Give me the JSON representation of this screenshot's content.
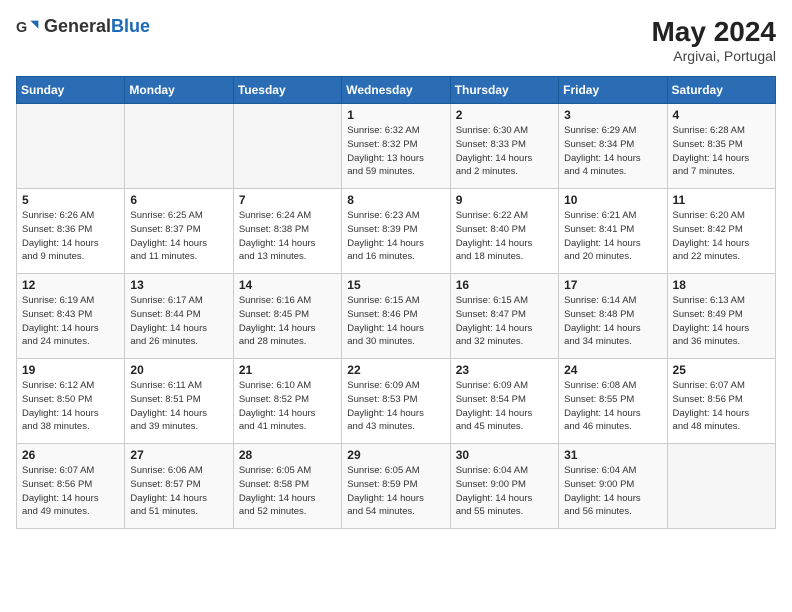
{
  "header": {
    "logo_general": "General",
    "logo_blue": "Blue",
    "month_year": "May 2024",
    "location": "Argivai, Portugal"
  },
  "days_of_week": [
    "Sunday",
    "Monday",
    "Tuesday",
    "Wednesday",
    "Thursday",
    "Friday",
    "Saturday"
  ],
  "weeks": [
    [
      {
        "day": "",
        "info": ""
      },
      {
        "day": "",
        "info": ""
      },
      {
        "day": "",
        "info": ""
      },
      {
        "day": "1",
        "info": "Sunrise: 6:32 AM\nSunset: 8:32 PM\nDaylight: 13 hours\nand 59 minutes."
      },
      {
        "day": "2",
        "info": "Sunrise: 6:30 AM\nSunset: 8:33 PM\nDaylight: 14 hours\nand 2 minutes."
      },
      {
        "day": "3",
        "info": "Sunrise: 6:29 AM\nSunset: 8:34 PM\nDaylight: 14 hours\nand 4 minutes."
      },
      {
        "day": "4",
        "info": "Sunrise: 6:28 AM\nSunset: 8:35 PM\nDaylight: 14 hours\nand 7 minutes."
      }
    ],
    [
      {
        "day": "5",
        "info": "Sunrise: 6:26 AM\nSunset: 8:36 PM\nDaylight: 14 hours\nand 9 minutes."
      },
      {
        "day": "6",
        "info": "Sunrise: 6:25 AM\nSunset: 8:37 PM\nDaylight: 14 hours\nand 11 minutes."
      },
      {
        "day": "7",
        "info": "Sunrise: 6:24 AM\nSunset: 8:38 PM\nDaylight: 14 hours\nand 13 minutes."
      },
      {
        "day": "8",
        "info": "Sunrise: 6:23 AM\nSunset: 8:39 PM\nDaylight: 14 hours\nand 16 minutes."
      },
      {
        "day": "9",
        "info": "Sunrise: 6:22 AM\nSunset: 8:40 PM\nDaylight: 14 hours\nand 18 minutes."
      },
      {
        "day": "10",
        "info": "Sunrise: 6:21 AM\nSunset: 8:41 PM\nDaylight: 14 hours\nand 20 minutes."
      },
      {
        "day": "11",
        "info": "Sunrise: 6:20 AM\nSunset: 8:42 PM\nDaylight: 14 hours\nand 22 minutes."
      }
    ],
    [
      {
        "day": "12",
        "info": "Sunrise: 6:19 AM\nSunset: 8:43 PM\nDaylight: 14 hours\nand 24 minutes."
      },
      {
        "day": "13",
        "info": "Sunrise: 6:17 AM\nSunset: 8:44 PM\nDaylight: 14 hours\nand 26 minutes."
      },
      {
        "day": "14",
        "info": "Sunrise: 6:16 AM\nSunset: 8:45 PM\nDaylight: 14 hours\nand 28 minutes."
      },
      {
        "day": "15",
        "info": "Sunrise: 6:15 AM\nSunset: 8:46 PM\nDaylight: 14 hours\nand 30 minutes."
      },
      {
        "day": "16",
        "info": "Sunrise: 6:15 AM\nSunset: 8:47 PM\nDaylight: 14 hours\nand 32 minutes."
      },
      {
        "day": "17",
        "info": "Sunrise: 6:14 AM\nSunset: 8:48 PM\nDaylight: 14 hours\nand 34 minutes."
      },
      {
        "day": "18",
        "info": "Sunrise: 6:13 AM\nSunset: 8:49 PM\nDaylight: 14 hours\nand 36 minutes."
      }
    ],
    [
      {
        "day": "19",
        "info": "Sunrise: 6:12 AM\nSunset: 8:50 PM\nDaylight: 14 hours\nand 38 minutes."
      },
      {
        "day": "20",
        "info": "Sunrise: 6:11 AM\nSunset: 8:51 PM\nDaylight: 14 hours\nand 39 minutes."
      },
      {
        "day": "21",
        "info": "Sunrise: 6:10 AM\nSunset: 8:52 PM\nDaylight: 14 hours\nand 41 minutes."
      },
      {
        "day": "22",
        "info": "Sunrise: 6:09 AM\nSunset: 8:53 PM\nDaylight: 14 hours\nand 43 minutes."
      },
      {
        "day": "23",
        "info": "Sunrise: 6:09 AM\nSunset: 8:54 PM\nDaylight: 14 hours\nand 45 minutes."
      },
      {
        "day": "24",
        "info": "Sunrise: 6:08 AM\nSunset: 8:55 PM\nDaylight: 14 hours\nand 46 minutes."
      },
      {
        "day": "25",
        "info": "Sunrise: 6:07 AM\nSunset: 8:56 PM\nDaylight: 14 hours\nand 48 minutes."
      }
    ],
    [
      {
        "day": "26",
        "info": "Sunrise: 6:07 AM\nSunset: 8:56 PM\nDaylight: 14 hours\nand 49 minutes."
      },
      {
        "day": "27",
        "info": "Sunrise: 6:06 AM\nSunset: 8:57 PM\nDaylight: 14 hours\nand 51 minutes."
      },
      {
        "day": "28",
        "info": "Sunrise: 6:05 AM\nSunset: 8:58 PM\nDaylight: 14 hours\nand 52 minutes."
      },
      {
        "day": "29",
        "info": "Sunrise: 6:05 AM\nSunset: 8:59 PM\nDaylight: 14 hours\nand 54 minutes."
      },
      {
        "day": "30",
        "info": "Sunrise: 6:04 AM\nSunset: 9:00 PM\nDaylight: 14 hours\nand 55 minutes."
      },
      {
        "day": "31",
        "info": "Sunrise: 6:04 AM\nSunset: 9:00 PM\nDaylight: 14 hours\nand 56 minutes."
      },
      {
        "day": "",
        "info": ""
      }
    ]
  ]
}
